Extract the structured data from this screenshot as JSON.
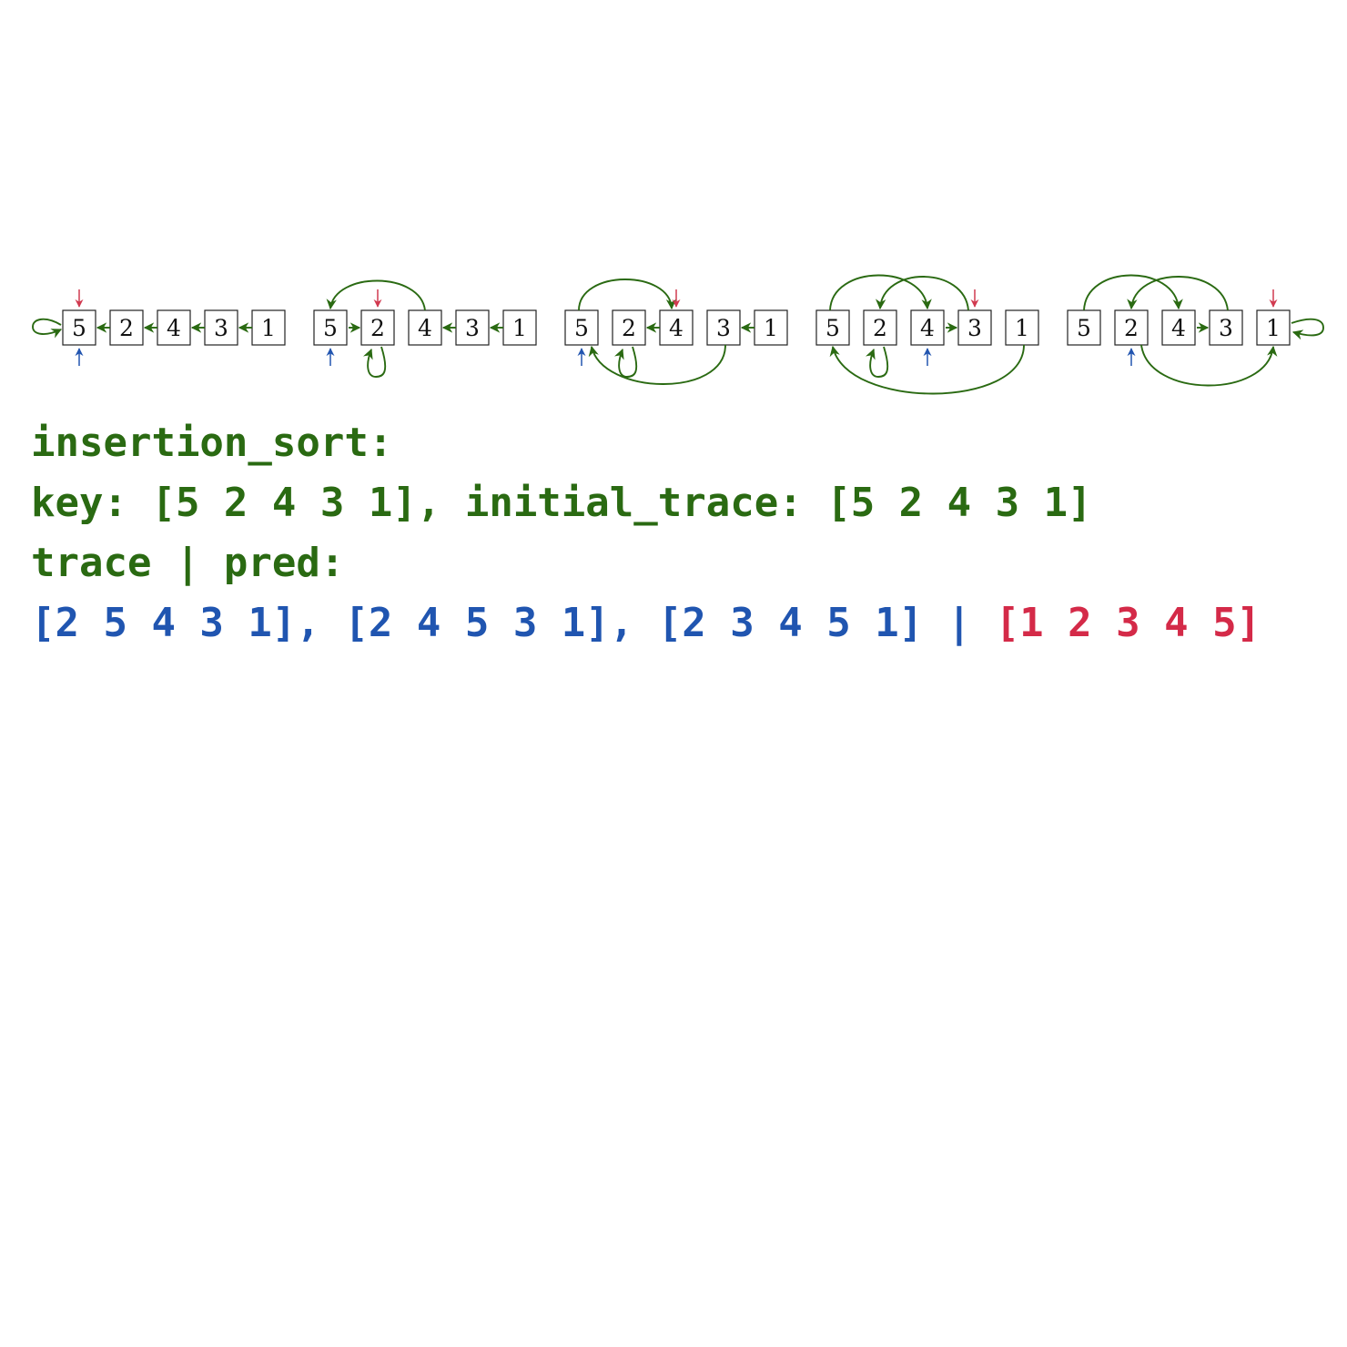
{
  "colors": {
    "pointer_green": "#2a6a12",
    "current_red": "#d13a50",
    "boundary_blue": "#2255b0",
    "trace_blue": "#2055b0",
    "pred_red": "#d42a48"
  },
  "panels": [
    {
      "values": [
        "5",
        "2",
        "4",
        "3",
        "1"
      ]
    },
    {
      "values": [
        "5",
        "2",
        "4",
        "3",
        "1"
      ]
    },
    {
      "values": [
        "5",
        "2",
        "4",
        "3",
        "1"
      ]
    },
    {
      "values": [
        "5",
        "2",
        "4",
        "3",
        "1"
      ]
    },
    {
      "values": [
        "5",
        "2",
        "4",
        "3",
        "1"
      ]
    }
  ],
  "text": {
    "title": "insertion_sort:",
    "key_label": "key: ",
    "key_value": "[5 2 4 3 1]",
    "initial_label": ", initial_trace: ",
    "initial_value": "[5 2 4 3 1]",
    "trace_pred_label": "trace | pred:",
    "trace_1": "[2 5 4 3 1]",
    "trace_2": "[2 4 5 3 1]",
    "trace_3": "[2 3 4 5 1]",
    "comma_sep": ", ",
    "pipe_sep": " | ",
    "pred": "[1 2 3 4 5]"
  }
}
